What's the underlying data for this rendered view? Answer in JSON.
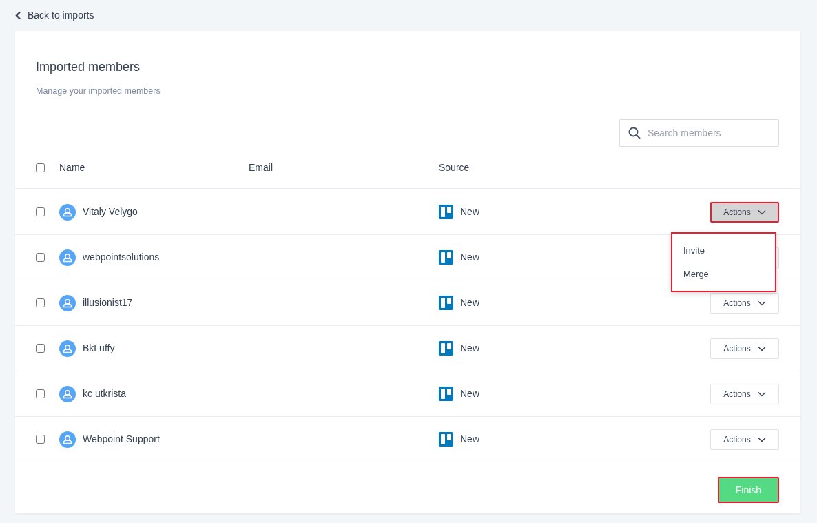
{
  "back_link": {
    "label": "Back to imports"
  },
  "header": {
    "title": "Imported members",
    "subtitle": "Manage your imported members"
  },
  "search": {
    "placeholder": "Search members"
  },
  "table": {
    "select_all_checked": false,
    "columns": [
      "Name",
      "Email",
      "Source"
    ],
    "rows": [
      {
        "name": "Vitaly Velygo",
        "source": "New",
        "checked": false,
        "actions": "Actions",
        "expanded": true,
        "highlighted": true
      },
      {
        "name": "webpointsolutions",
        "source": "New",
        "checked": false,
        "expanded": false,
        "highlighted": false
      },
      {
        "name": "illusionist17",
        "source": "New",
        "checked": false,
        "actions": "Actions",
        "expanded": false,
        "highlighted": false
      },
      {
        "name": "BkLuffy",
        "source": "New",
        "checked": false,
        "actions": "Actions",
        "expanded": false,
        "highlighted": false
      },
      {
        "name": "kc utkrista",
        "source": "New",
        "checked": false,
        "actions": "Actions",
        "expanded": false,
        "highlighted": false
      },
      {
        "name": "Webpoint Support",
        "source": "New",
        "checked": false,
        "actions": "Actions",
        "expanded": false,
        "highlighted": false
      }
    ]
  },
  "actions_menu": {
    "highlighted": true,
    "items": [
      "Invite",
      "Merge"
    ]
  },
  "finish_button": {
    "label": "Finish",
    "highlighted": true
  }
}
